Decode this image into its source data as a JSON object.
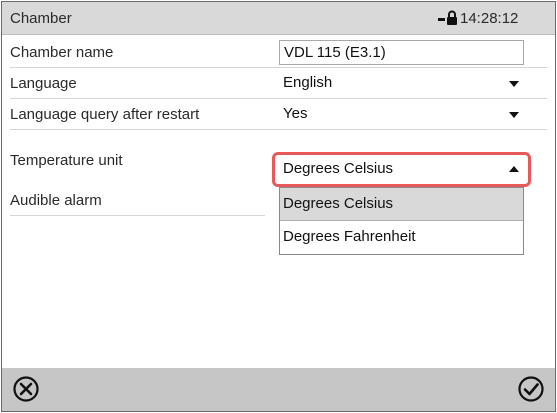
{
  "titlebar": {
    "title": "Chamber",
    "lock_icon": "lock-icon",
    "time": "14:28:12"
  },
  "settings": [
    {
      "label": "Chamber name",
      "control": "text",
      "value": "VDL 115 (E3.1)"
    },
    {
      "label": "Language",
      "control": "select",
      "value": "English"
    },
    {
      "label": "Language query after restart",
      "control": "select",
      "value": "Yes"
    },
    {
      "label": "Temperature unit",
      "control": "select-open",
      "value": "Degrees Celsius"
    },
    {
      "label": "Audible alarm",
      "control": "none",
      "value": ""
    }
  ],
  "temperature_dropdown": {
    "options": [
      "Degrees Celsius",
      "Degrees Fahrenheit"
    ],
    "highlighted": "Degrees Celsius"
  },
  "bottombar": {
    "cancel_icon": "close-icon",
    "confirm_icon": "checkmark-icon"
  },
  "colors": {
    "titlebar_bg": "#d9d9d9",
    "bottombar_bg": "#c6c6c6",
    "focus_border": "#e85a5a",
    "option_highlight": "#d9d9d9"
  }
}
